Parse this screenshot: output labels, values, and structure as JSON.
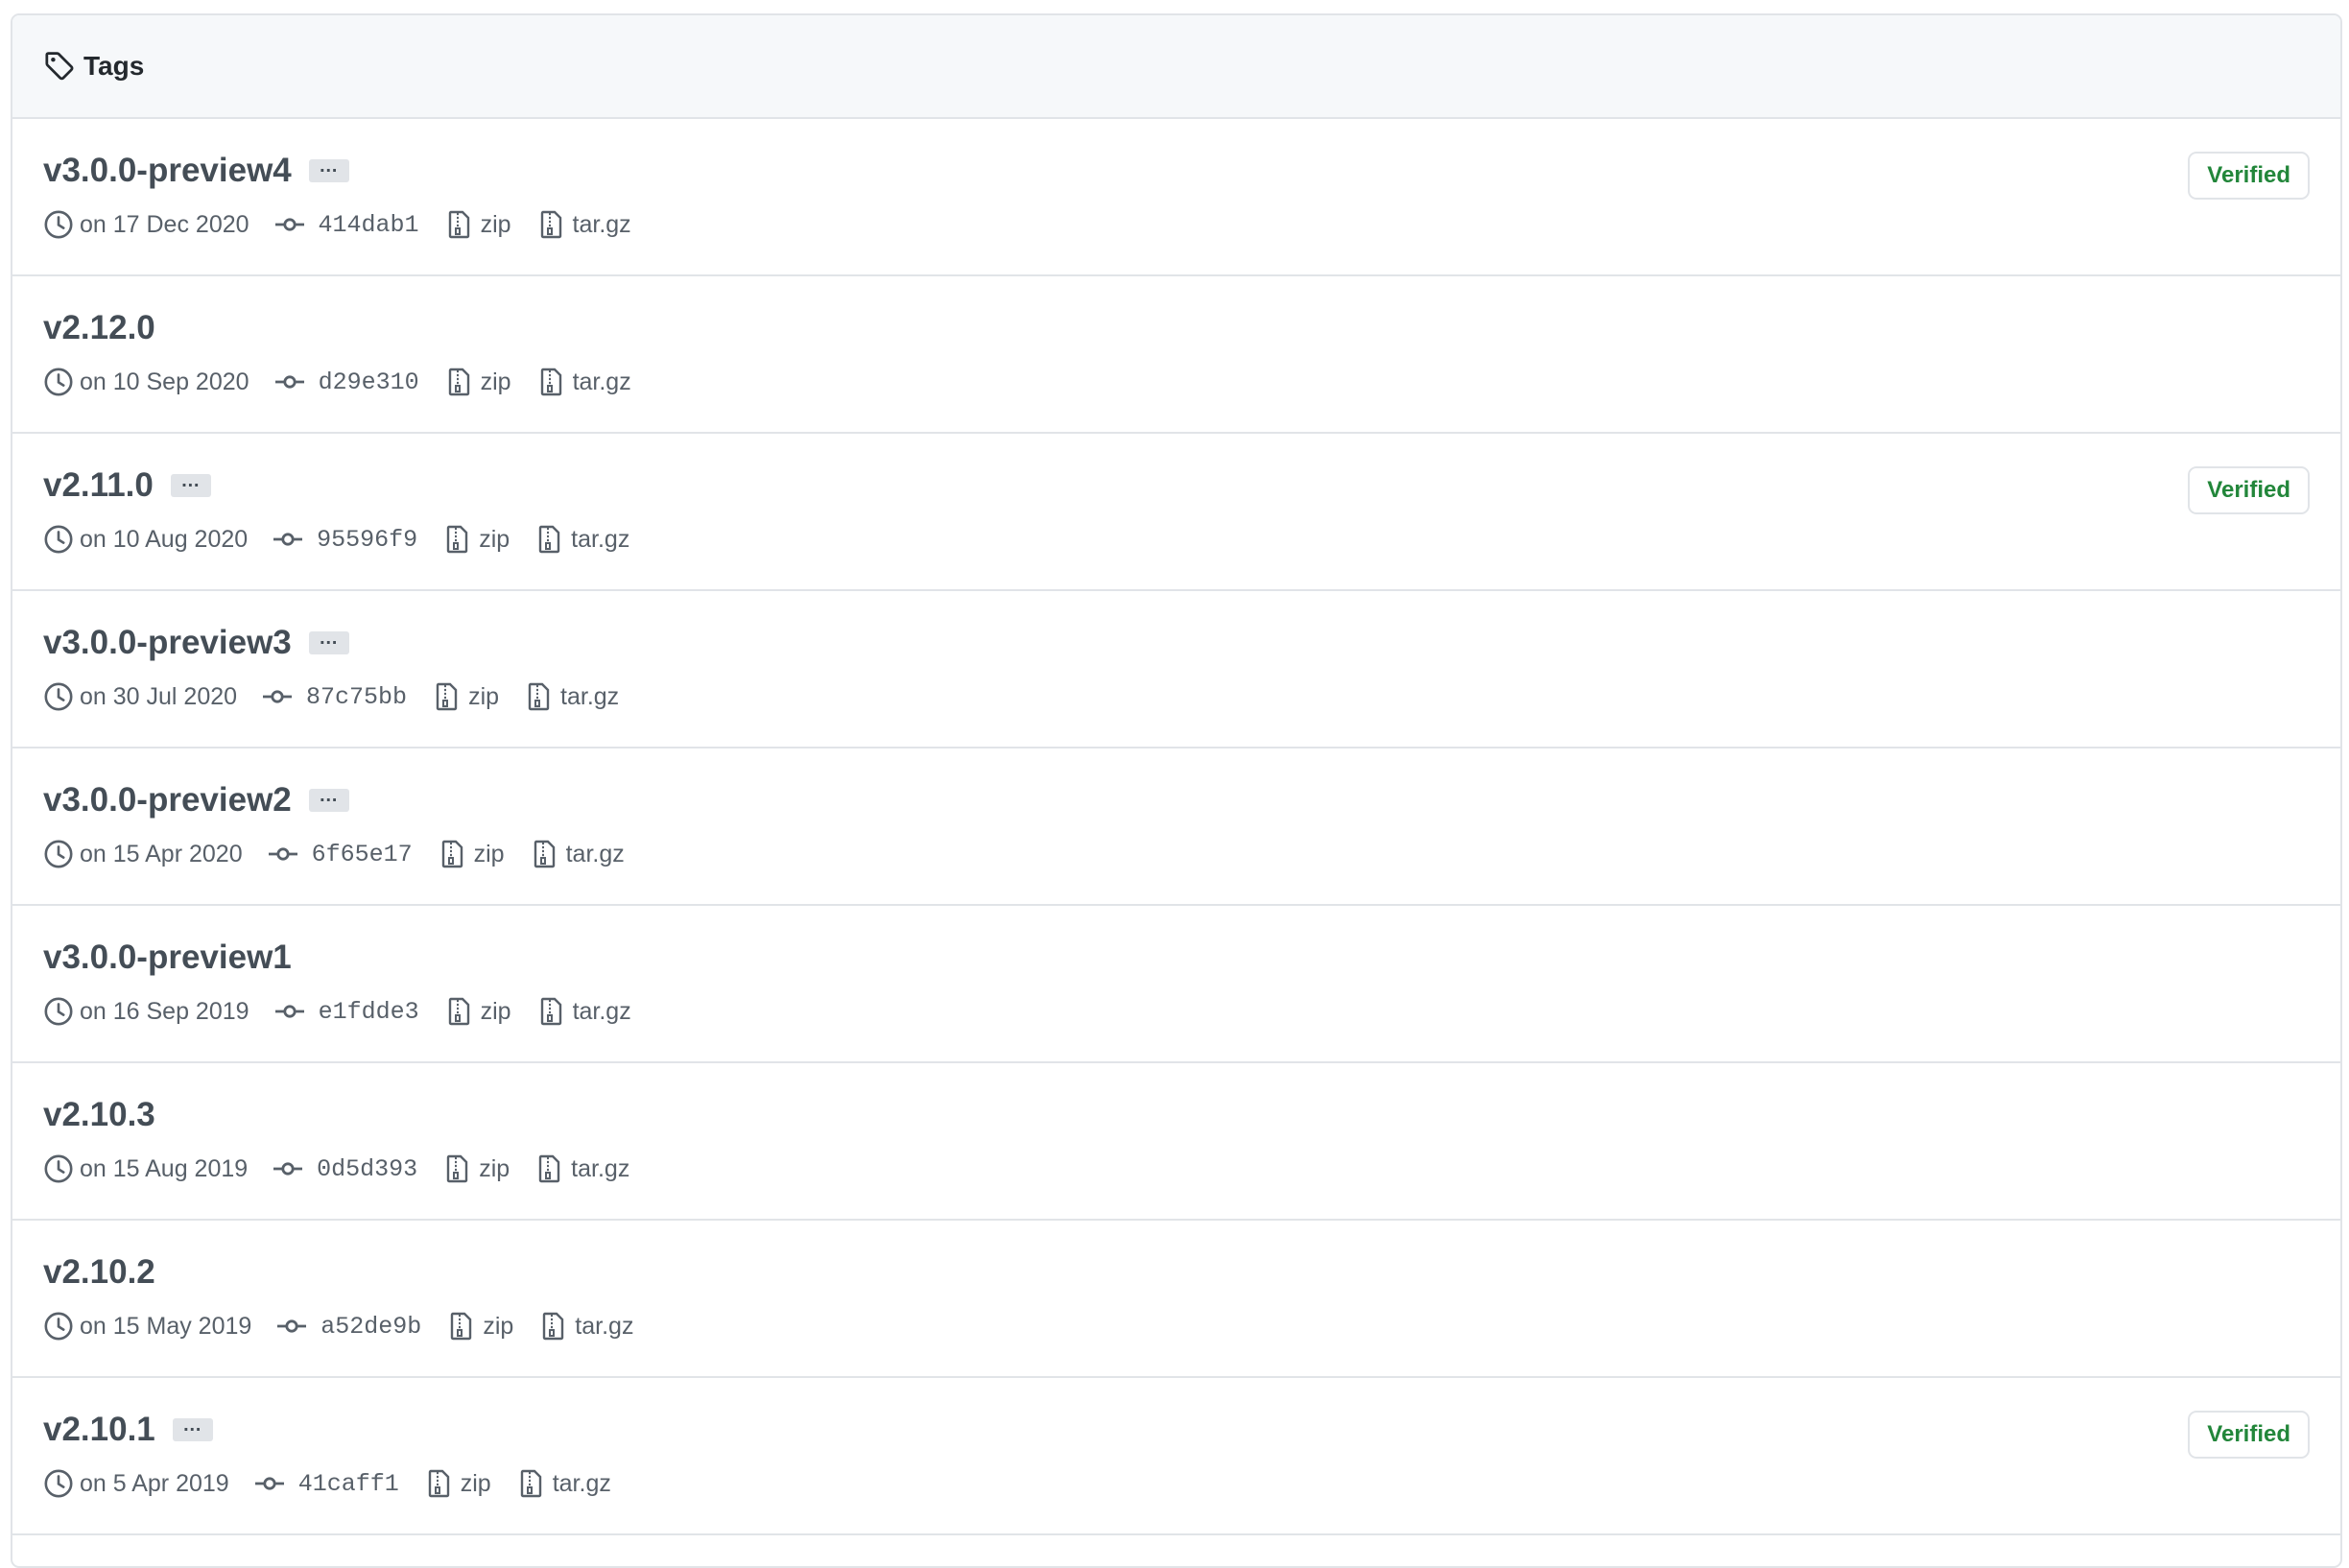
{
  "header": {
    "title": "Tags",
    "icon": "tag-icon"
  },
  "tags": [
    {
      "name": "v3.0.0-preview4",
      "has_ellipsis": true,
      "date": "on 17 Dec 2020",
      "sha": "414dab1",
      "zip": "zip",
      "targz": "tar.gz",
      "verified": "Verified"
    },
    {
      "name": "v2.12.0",
      "has_ellipsis": false,
      "date": "on 10 Sep 2020",
      "sha": "d29e310",
      "zip": "zip",
      "targz": "tar.gz",
      "verified": ""
    },
    {
      "name": "v2.11.0",
      "has_ellipsis": true,
      "date": "on 10 Aug 2020",
      "sha": "95596f9",
      "zip": "zip",
      "targz": "tar.gz",
      "verified": "Verified"
    },
    {
      "name": "v3.0.0-preview3",
      "has_ellipsis": true,
      "date": "on 30 Jul 2020",
      "sha": "87c75bb",
      "zip": "zip",
      "targz": "tar.gz",
      "verified": ""
    },
    {
      "name": "v3.0.0-preview2",
      "has_ellipsis": true,
      "date": "on 15 Apr 2020",
      "sha": "6f65e17",
      "zip": "zip",
      "targz": "tar.gz",
      "verified": ""
    },
    {
      "name": "v3.0.0-preview1",
      "has_ellipsis": false,
      "date": "on 16 Sep 2019",
      "sha": "e1fdde3",
      "zip": "zip",
      "targz": "tar.gz",
      "verified": ""
    },
    {
      "name": "v2.10.3",
      "has_ellipsis": false,
      "date": "on 15 Aug 2019",
      "sha": "0d5d393",
      "zip": "zip",
      "targz": "tar.gz",
      "verified": ""
    },
    {
      "name": "v2.10.2",
      "has_ellipsis": false,
      "date": "on 15 May 2019",
      "sha": "a52de9b",
      "zip": "zip",
      "targz": "tar.gz",
      "verified": ""
    },
    {
      "name": "v2.10.1",
      "has_ellipsis": true,
      "date": "on 5 Apr 2019",
      "sha": "41caff1",
      "zip": "zip",
      "targz": "tar.gz",
      "verified": "Verified"
    }
  ],
  "colors": {
    "verified": "#22863a",
    "border": "#e1e4e8",
    "header_bg": "#f6f8fa",
    "meta_text": "#586069"
  }
}
